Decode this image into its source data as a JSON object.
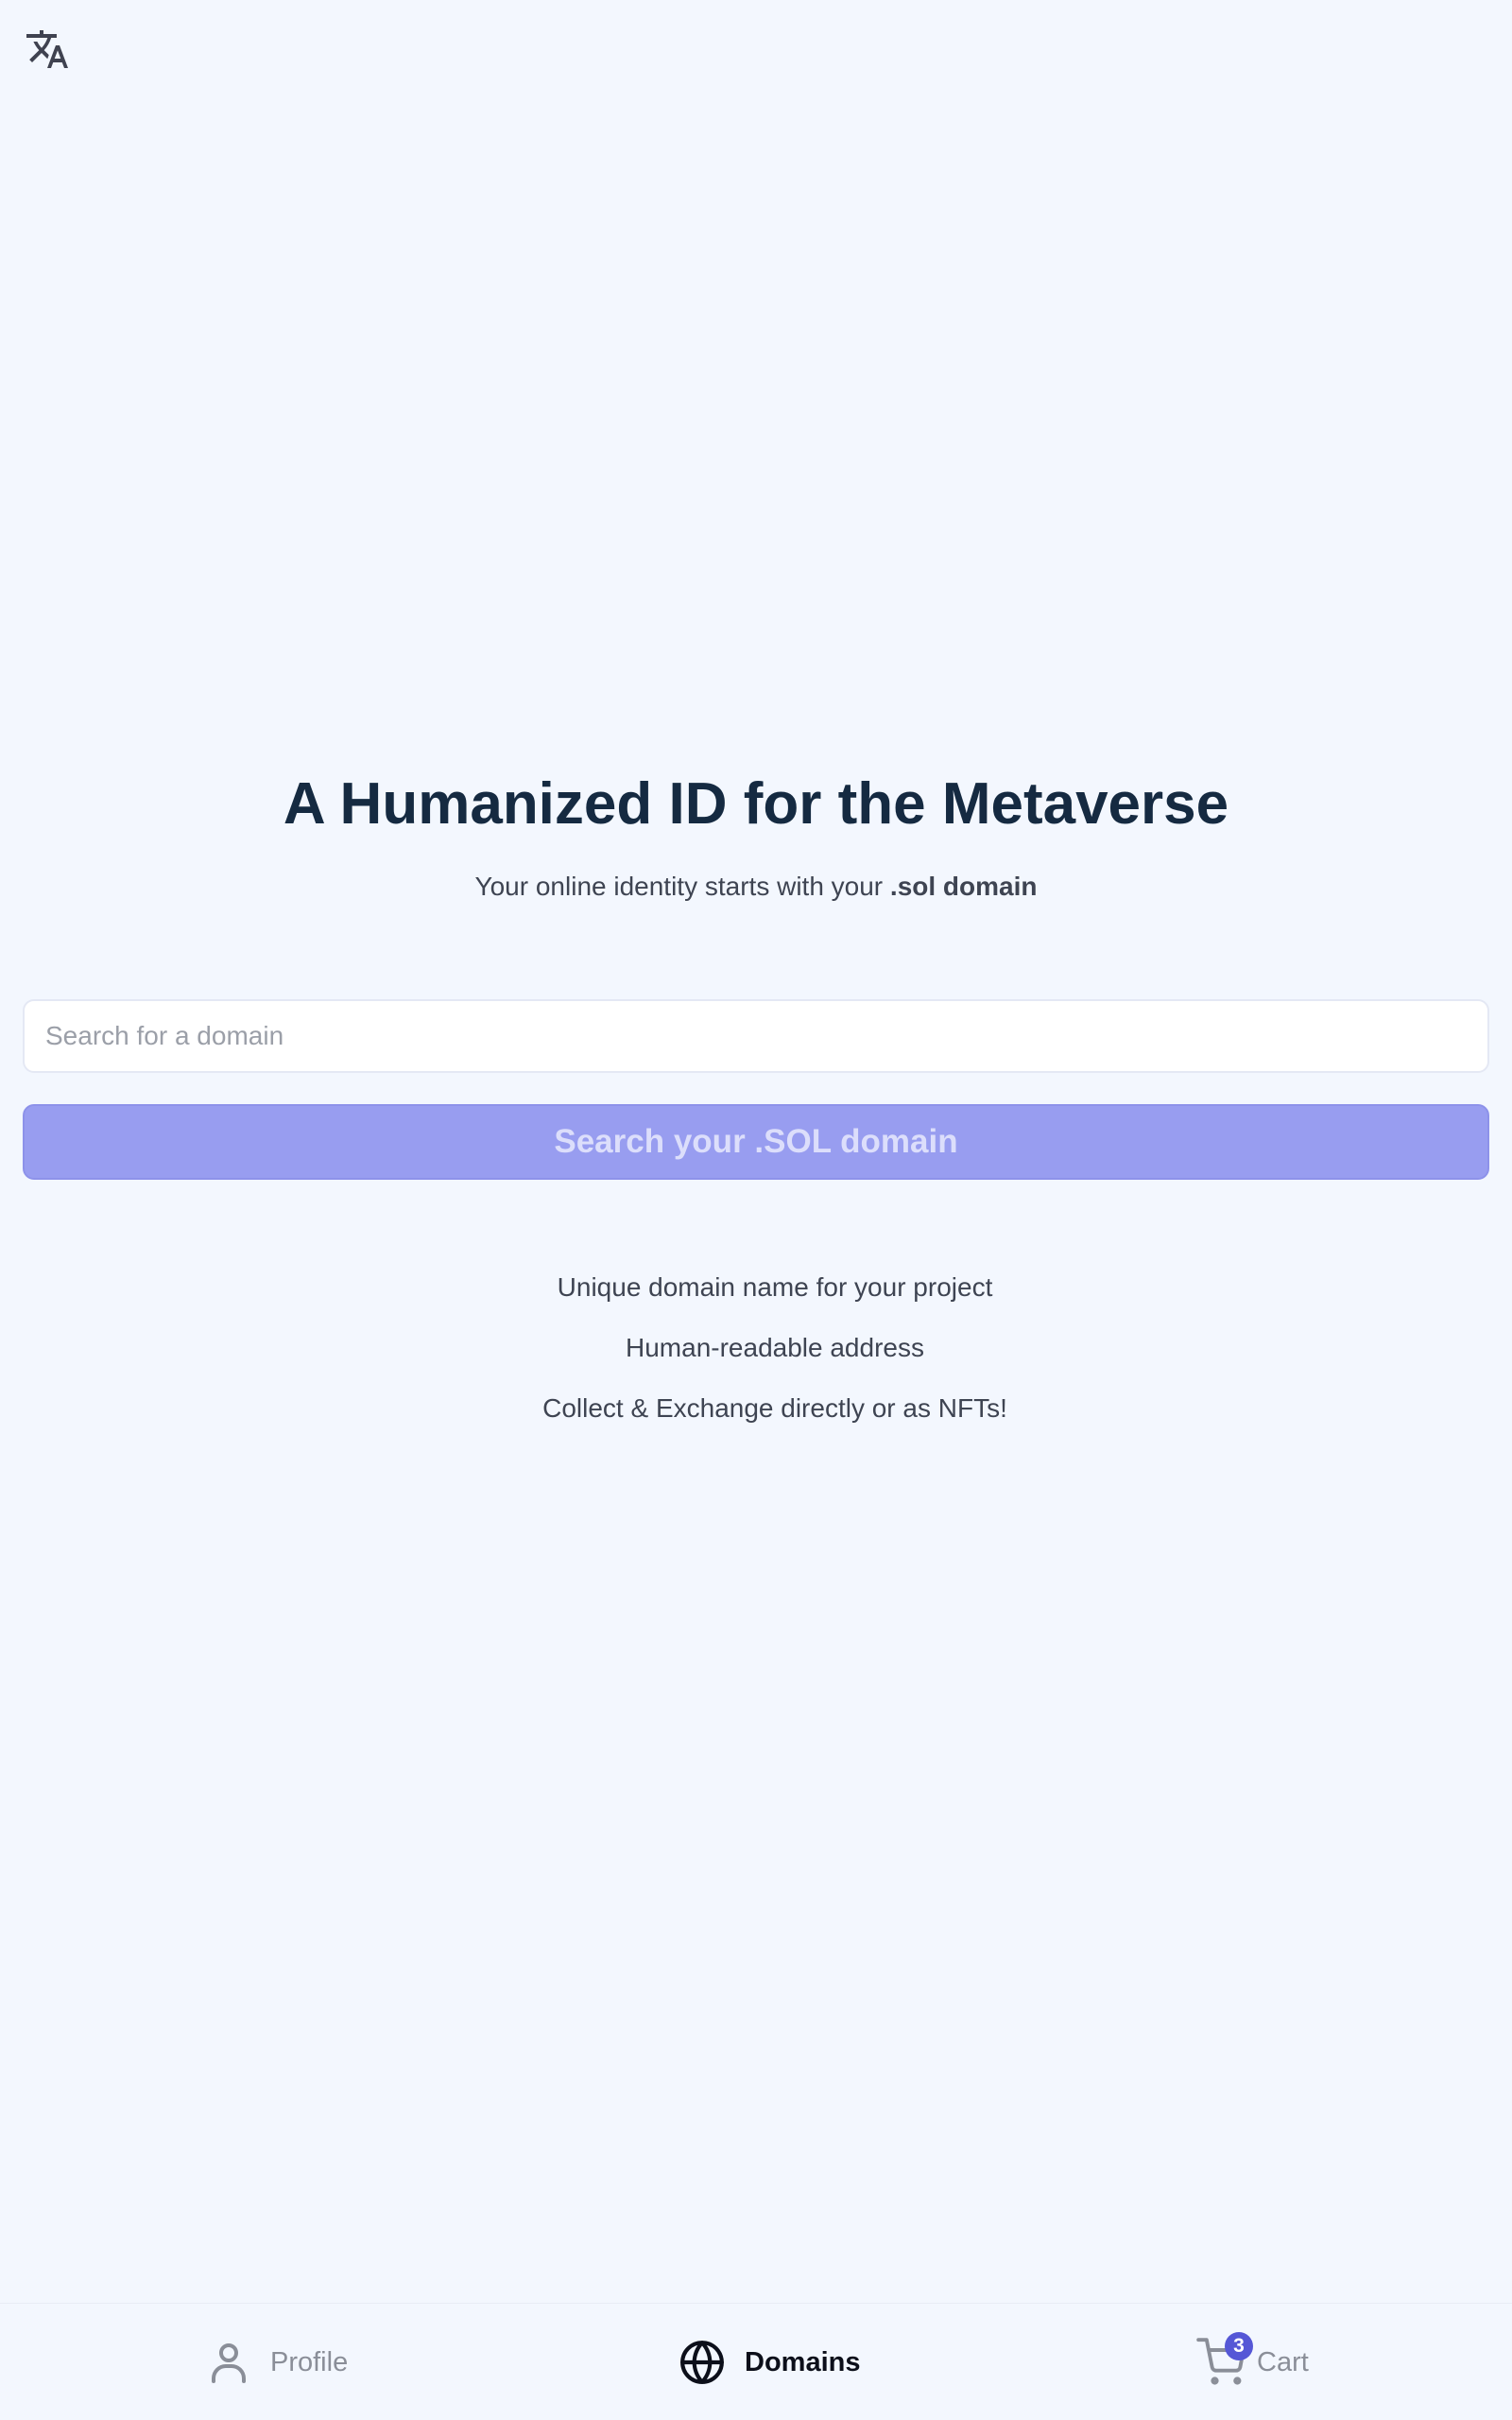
{
  "top_bar": {
    "translate_icon": "translate-icon"
  },
  "hero": {
    "title": "A Humanized ID for the Metaverse",
    "subtitle_prefix": "Your online identity starts with your ",
    "subtitle_bold": ".sol domain"
  },
  "search": {
    "placeholder": "Search for a domain",
    "value": "",
    "button_label": "Search your .SOL domain"
  },
  "features": [
    "Unique domain name for your project",
    "Human-readable address",
    "Collect & Exchange directly or as NFTs!"
  ],
  "bottom_nav": {
    "items": [
      {
        "label": "Profile",
        "icon": "user-icon",
        "active": false
      },
      {
        "label": "Domains",
        "icon": "globe-icon",
        "active": true
      },
      {
        "label": "Cart",
        "icon": "cart-icon",
        "active": false,
        "badge": "3"
      }
    ]
  },
  "colors": {
    "background": "#f3f7fe",
    "title": "#152a41",
    "button_bg": "#989df0",
    "button_text": "#dcdefb",
    "badge": "#5557d6"
  }
}
